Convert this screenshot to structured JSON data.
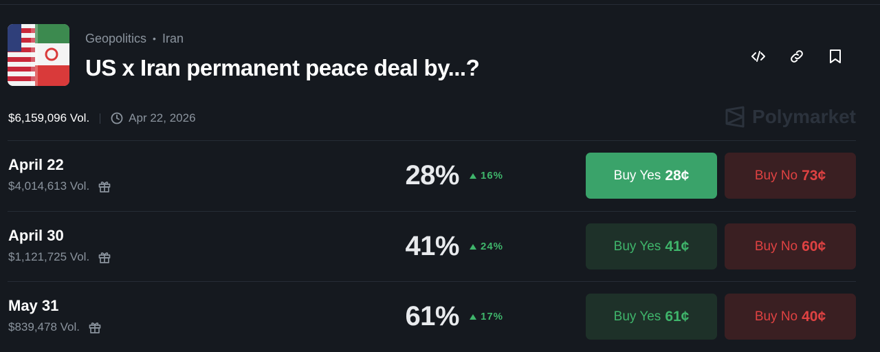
{
  "market": {
    "category": "Geopolitics",
    "tag": "Iran",
    "title": "US x Iran permanent peace deal by...?",
    "volume": "$6,159,096 Vol.",
    "end_date": "Apr 22, 2026",
    "brand": "Polymarket"
  },
  "icons": {
    "embed": "code-icon",
    "link": "link-icon",
    "bookmark": "bookmark-icon",
    "clock": "clock-icon",
    "gift": "gift-icon",
    "logo": "polymarket-logo-icon"
  },
  "colors": {
    "background": "#15191f",
    "up": "#3fb56b",
    "yes_active": "#3aa36a",
    "no": "#e04242"
  },
  "outcomes": [
    {
      "name": "April 22",
      "volume": "$4,014,613 Vol.",
      "probability": "28%",
      "change": "16%",
      "yes_label": "Buy Yes",
      "yes_price": "28¢",
      "no_label": "Buy No",
      "no_price": "73¢"
    },
    {
      "name": "April 30",
      "volume": "$1,121,725 Vol.",
      "probability": "41%",
      "change": "24%",
      "yes_label": "Buy Yes",
      "yes_price": "41¢",
      "no_label": "Buy No",
      "no_price": "60¢"
    },
    {
      "name": "May 31",
      "volume": "$839,478 Vol.",
      "probability": "61%",
      "change": "17%",
      "yes_label": "Buy Yes",
      "yes_price": "61¢",
      "no_label": "Buy No",
      "no_price": "40¢"
    }
  ]
}
